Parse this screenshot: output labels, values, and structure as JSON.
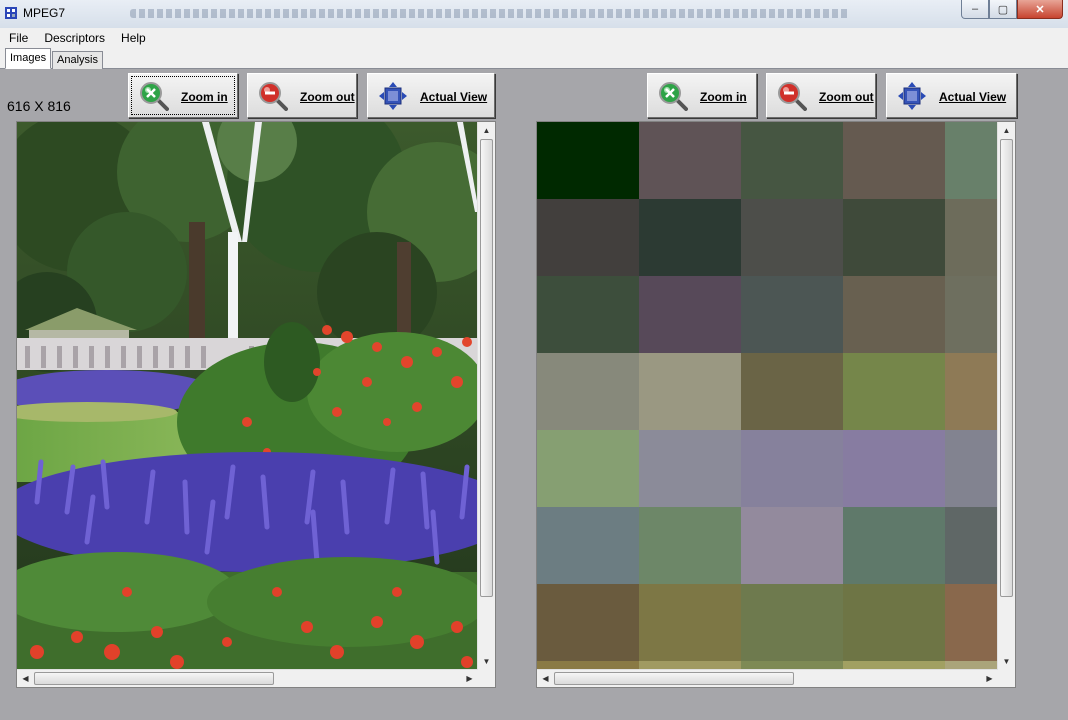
{
  "window": {
    "title": "MPEG7",
    "controls": {
      "minimize": "–",
      "maximize": "▢",
      "close": "✕"
    }
  },
  "menu": {
    "items": [
      "File",
      "Descriptors",
      "Help"
    ]
  },
  "tabs": [
    {
      "label": "Images",
      "active": true
    },
    {
      "label": "Analysis",
      "active": false
    }
  ],
  "left_toolbar": {
    "zoom_in": "Zoom in",
    "zoom_out": "Zoom out",
    "actual_view": "Actual View"
  },
  "right_toolbar": {
    "zoom_in": "Zoom in",
    "zoom_out": "Zoom out",
    "actual_view": "Actual View"
  },
  "image_size_label": "616 X 816",
  "descriptor_grid": {
    "rows": [
      [
        "#002900",
        "#5f5356",
        "#465642",
        "#655a50",
        "#68806a"
      ],
      [
        "#423f3d",
        "#2c3a33",
        "#4d4e4a",
        "#3f4a3a",
        "#6d6c5b"
      ],
      [
        "#3d4e3c",
        "#574959",
        "#4c5654",
        "#686050",
        "#6e6f5f"
      ],
      [
        "#87897b",
        "#9a9882",
        "#6a6446",
        "#75864a",
        "#8e7a56"
      ],
      [
        "#869f72",
        "#8b8b99",
        "#86819c",
        "#877ca1",
        "#828390"
      ],
      [
        "#6c7d82",
        "#6d8768",
        "#938a9d",
        "#5f796a",
        "#5f6766"
      ],
      [
        "#6a5b3e",
        "#7d7745",
        "#6e7a4e",
        "#6e7545",
        "#89684c"
      ],
      [
        "#8a7a45",
        "#a09a62",
        "#7e8a55",
        "#a1a062",
        "#aaa47a"
      ]
    ]
  },
  "colors": {
    "desktop": "#a6a6aa",
    "menu_bg": "#f0f0f0",
    "zoom_in_accent": "#22a33a",
    "zoom_out_accent": "#c8281e",
    "actual_view_accent": "#2a4bb5"
  }
}
